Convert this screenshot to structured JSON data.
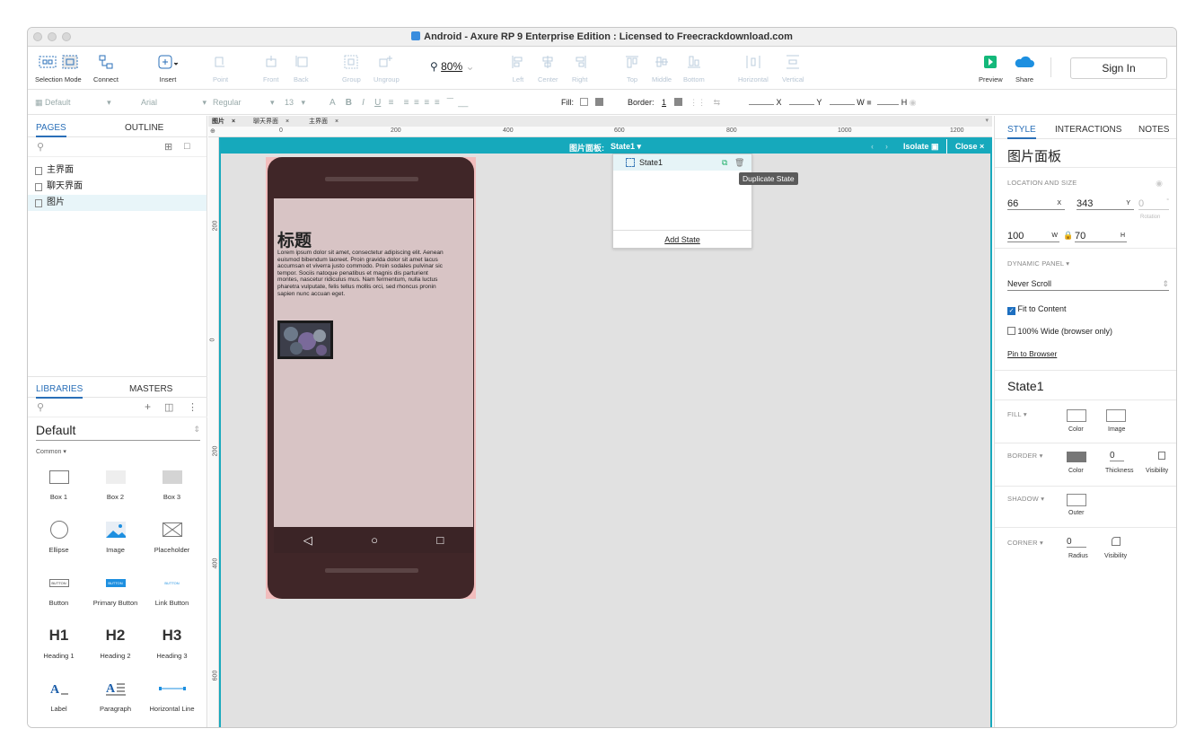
{
  "window": {
    "title": "Android - Axure RP 9 Enterprise Edition : Licensed to Freecrackdownload.com"
  },
  "toolbar": {
    "selection_mode": "Selection Mode",
    "connect": "Connect",
    "insert": "Insert",
    "point": "Point",
    "front": "Front",
    "back": "Back",
    "group": "Group",
    "ungroup": "Ungroup",
    "zoom": "80%",
    "left": "Left",
    "center": "Center",
    "right": "Right",
    "top": "Top",
    "middle": "Middle",
    "bottom": "Bottom",
    "horizontal": "Horizontal",
    "vertical": "Vertical",
    "preview": "Preview",
    "share": "Share",
    "sign_in": "Sign In"
  },
  "formatbar": {
    "style": "Default",
    "font": "Arial",
    "weight": "Regular",
    "size": "13",
    "fill_label": "Fill:",
    "border_label": "Border:",
    "border_value": "1",
    "x": "X",
    "y": "Y",
    "w": "W",
    "h": "H"
  },
  "left": {
    "tab_pages": "PAGES",
    "tab_outline": "OUTLINE",
    "pages": [
      "主界面",
      "聊天界面",
      "图片"
    ],
    "selected_page": "图片",
    "tab_libraries": "LIBRARIES",
    "tab_masters": "MASTERS",
    "library": "Default",
    "category": "Common ▾",
    "widgets": [
      "Box 1",
      "Box 2",
      "Box 3",
      "Ellipse",
      "Image",
      "Placeholder",
      "Button",
      "Primary Button",
      "Link Button",
      "Heading 1",
      "Heading 2",
      "Heading 3",
      "Label",
      "Paragraph",
      "Horizontal Line"
    ],
    "button_text": "BUTTON",
    "h1": "H1",
    "h2": "H2",
    "h3": "H3"
  },
  "canvas": {
    "tabs": [
      "图片",
      "聊天界面",
      "主界面"
    ],
    "ruler_h": [
      "0",
      "200",
      "400",
      "600",
      "800",
      "1000",
      "1200"
    ],
    "ruler_v": [
      "200",
      "0",
      "200",
      "400",
      "600"
    ],
    "panel_label": "图片面板:",
    "state": "State1",
    "isolate": "Isolate",
    "close": "Close",
    "state_item": "State1",
    "add_state": "Add State",
    "tooltip": "Duplicate State",
    "phone_title": "标题",
    "lorem": "Lorem ipsum dolor sit amet, consectetur adipiscing elit. Aenean euismod bibendum laoreet. Proin gravida dolor sit amet lacus accumsan et viverra justo commodo. Proin sodales pulvinar sic tempor. Sociis natoque penatibus et magnis dis parturient montes, nascetur ridiculus mus. Nam fermentum, nulla luctus pharetra vulputate, felis tellus mollis orci, sed rhoncus pronin sapien nunc accuan eget."
  },
  "right": {
    "tab_style": "STYLE",
    "tab_interactions": "INTERACTIONS",
    "tab_notes": "NOTES",
    "name": "图片面板",
    "loc_size": "LOCATION AND SIZE",
    "x": "66",
    "y": "343",
    "x_label": "X",
    "y_label": "Y",
    "rotation": "0",
    "rotation_label": "Rotation",
    "w": "100",
    "h": "70",
    "w_label": "W",
    "h_label": "H",
    "dynamic_panel": "DYNAMIC PANEL ▾",
    "scroll": "Never Scroll",
    "fit": "Fit to Content",
    "wide": "100% Wide (browser only)",
    "pin": "Pin to Browser",
    "state": "State1",
    "fill": "FILL ▾",
    "color": "Color",
    "image": "Image",
    "border": "BORDER ▾",
    "thickness_value": "0",
    "thickness": "Thickness",
    "visibility": "Visibility",
    "shadow": "SHADOW ▾",
    "outer": "Outer",
    "corner": "CORNER ▾",
    "radius_value": "0",
    "radius": "Radius"
  }
}
